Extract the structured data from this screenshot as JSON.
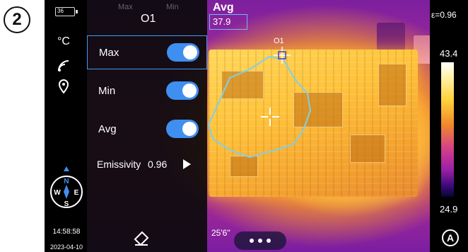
{
  "step_badge": "2",
  "status": {
    "battery": "36",
    "unit": "°C",
    "time": "14:58:58",
    "date": "2023-04-10"
  },
  "menu": {
    "title": "O1",
    "items": [
      {
        "label": "Max",
        "on": true,
        "selected": true
      },
      {
        "label": "Min",
        "on": true,
        "selected": false
      },
      {
        "label": "Avg",
        "on": true,
        "selected": false
      }
    ],
    "emissivity_label": "Emissivity",
    "emissivity_value": "0.96"
  },
  "readout": {
    "avg_title": "Avg",
    "avg_value": "37.9",
    "ghost_max": "Max",
    "ghost_min": "Min",
    "marker_label": "O1",
    "partial_text": "25'6\""
  },
  "scale": {
    "emissivity": "ε=0.96",
    "max": "43.4",
    "min": "24.9",
    "mode_icon": "A"
  },
  "compass": {
    "n": "N",
    "s": "S",
    "w": "W",
    "e": "E"
  },
  "colors": {
    "accent": "#3f8ff0",
    "highlight_border": "#6fb6ff"
  }
}
